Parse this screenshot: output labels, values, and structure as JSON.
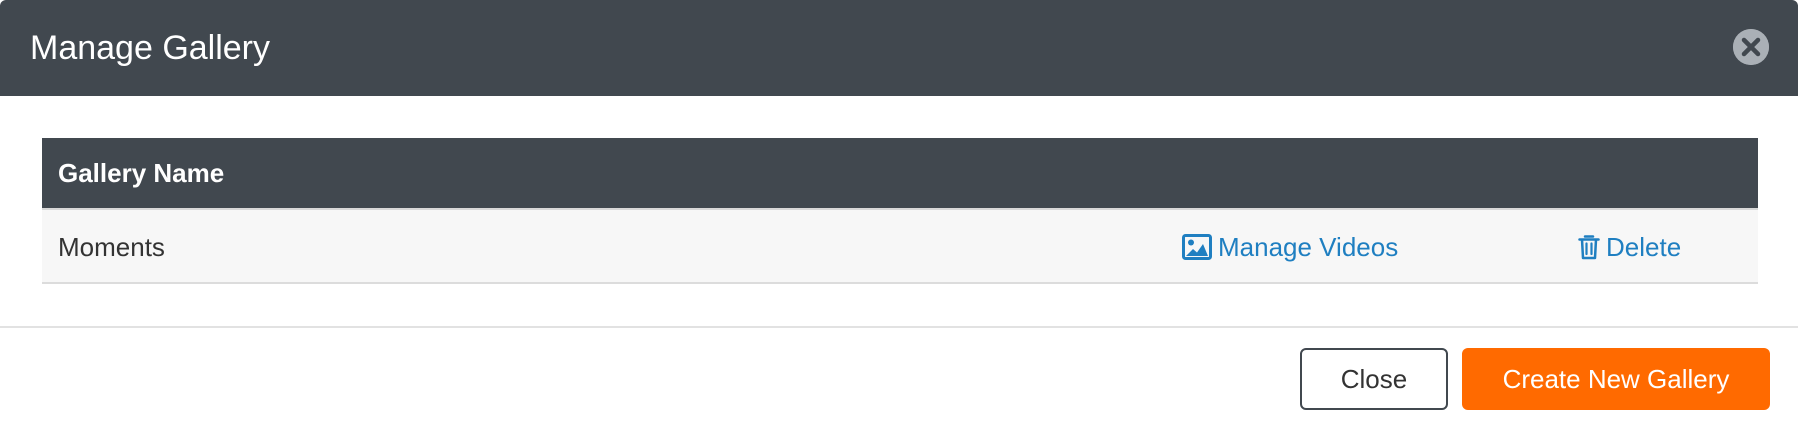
{
  "dialog": {
    "title": "Manage Gallery",
    "close_icon": "close-circle-icon"
  },
  "table": {
    "header": {
      "gallery_name": "Gallery Name"
    },
    "rows": [
      {
        "name": "Moments",
        "manage_label": "Manage Videos",
        "manage_icon": "image-icon",
        "delete_label": "Delete",
        "delete_icon": "trash-icon"
      }
    ]
  },
  "footer": {
    "close_label": "Close",
    "create_label": "Create New Gallery"
  },
  "colors": {
    "header_bg": "#41484f",
    "link": "#1f7fc1",
    "primary": "#ff6a00"
  }
}
